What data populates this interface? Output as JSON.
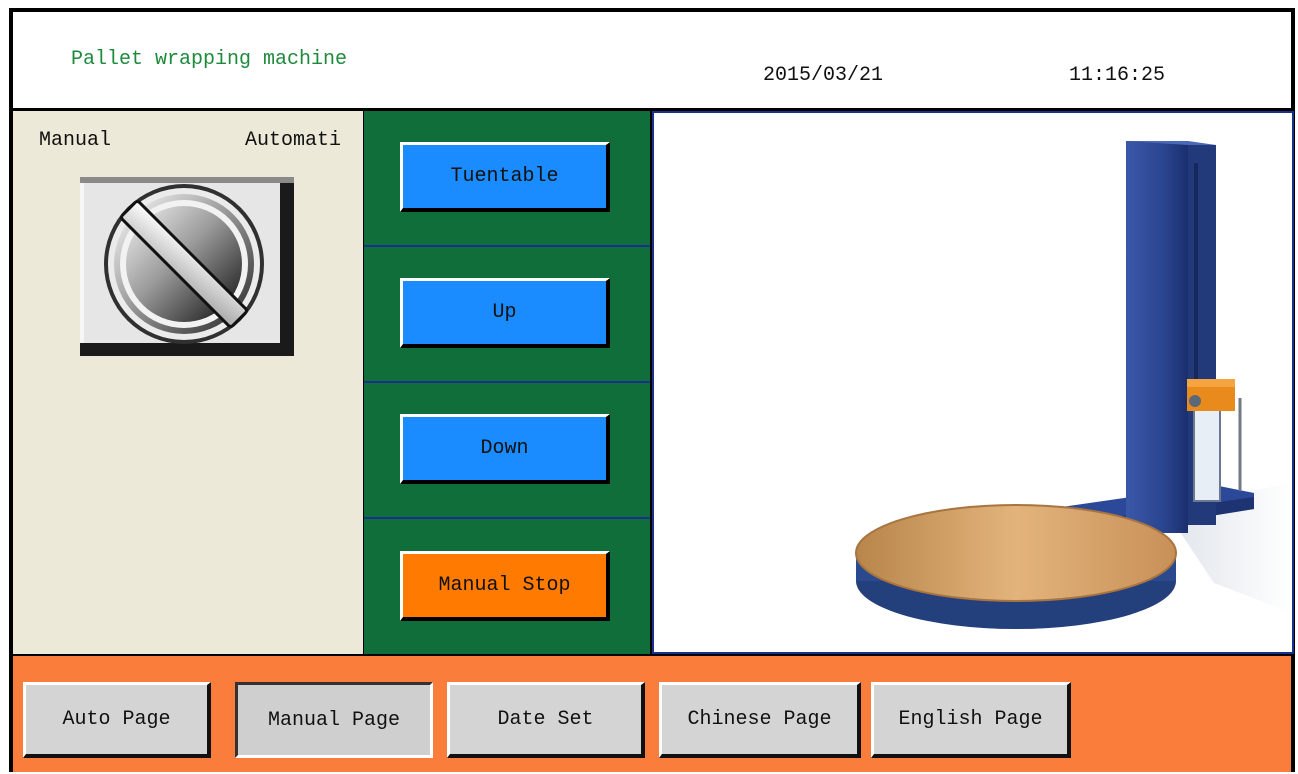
{
  "header": {
    "title": "Pallet wrapping machine",
    "date": "2015/03/21",
    "time": "11:16:25"
  },
  "mode_selector": {
    "left_label": "Manual",
    "right_label": "Automati",
    "icon": "rotary-selector-switch-icon"
  },
  "controls": {
    "turntable_label": "Tuentable",
    "up_label": "Up",
    "down_label": "Down",
    "stop_label": "Manual Stop"
  },
  "machine_image": {
    "icon": "pallet-wrapping-machine-illustration"
  },
  "nav": {
    "items": [
      {
        "label": "Auto Page"
      },
      {
        "label": "Manual Page"
      },
      {
        "label": "Date Set"
      },
      {
        "label": "Chinese Page"
      },
      {
        "label": "English Page"
      }
    ],
    "active": "Manual Page"
  },
  "colors": {
    "title_green": "#1e8a3c",
    "panel_green": "#0f6e3a",
    "button_blue": "#1a8cff",
    "button_orange": "#ff7a00",
    "footer_orange": "#fa7d3c",
    "beige": "#ece9d8"
  }
}
